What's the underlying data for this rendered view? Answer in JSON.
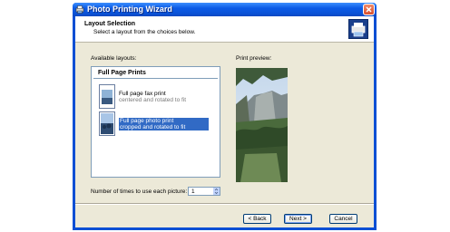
{
  "window": {
    "title": "Photo Printing Wizard"
  },
  "header": {
    "title": "Layout Selection",
    "subtitle": "Select a layout from the choices below."
  },
  "available_layouts_label": "Available layouts:",
  "print_preview_label": "Print preview:",
  "layout_category": "Full Page Prints",
  "layouts": [
    {
      "line1": "Full page fax print",
      "line2": "centered and rotated to fit",
      "selected": false
    },
    {
      "line1": "Full page photo print",
      "line2": "cropped and rotated to fit",
      "selected": true
    }
  ],
  "times_label": "Number of times to use each picture:",
  "times_value": "1",
  "buttons": {
    "back": "< Back",
    "next": "Next >",
    "cancel": "Cancel"
  },
  "icons": {
    "title": "printer-wizard-icon",
    "close": "close-icon",
    "header": "printer-photo-icon"
  }
}
